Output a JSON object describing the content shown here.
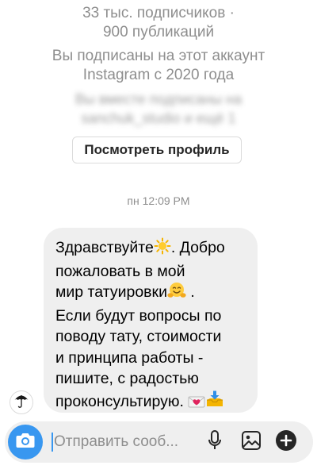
{
  "profile": {
    "followers_posts_line1": "33 тыс. подписчиков ·",
    "followers_posts_line2": "900 публикаций",
    "following_since_line1": "Вы подписаны на этот аккаунт",
    "following_since_line2": "Instagram с 2020 года",
    "mutual_blurred_line1": "Вы вместе подписаны на",
    "mutual_blurred_line2": "sanchuk_studio и ещё 1",
    "view_profile_label": "Посмотреть профиль"
  },
  "thread": {
    "timestamp": "пн 12:09 PM",
    "message": {
      "line1": "Здравствуйте",
      "line1b": ". Добро",
      "line2": "пожаловать в мой",
      "line3": "мир татуировки",
      "line3b": " .",
      "line4": "Если будут вопросы по",
      "line5": "поводу тату, стоимости",
      "line6": "и принципа работы -",
      "line7": "пишите, с радостью",
      "line8": "проконсультирую. "
    }
  },
  "composer": {
    "placeholder": "Отправить сооб..."
  },
  "colors": {
    "accent": "#3897f0",
    "bubble": "#efefef",
    "muted": "#8e8e8e"
  },
  "icons": {
    "camera": "camera-icon",
    "mic": "microphone-icon",
    "gallery": "gallery-icon",
    "plus": "plus-circle-icon",
    "avatar": "umbrella-icon"
  }
}
